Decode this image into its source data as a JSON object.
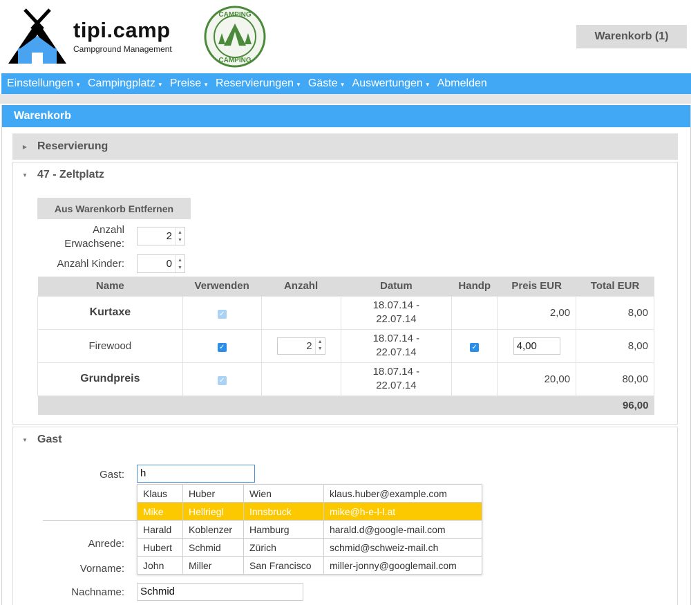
{
  "header": {
    "brand_title": "tipi.camp",
    "brand_subtitle": "Campground Management",
    "badge_text": "CAMPING",
    "cart_label": "Warenkorb (1)"
  },
  "nav": {
    "items": [
      {
        "label": "Einstellungen",
        "dropdown": true
      },
      {
        "label": "Campingplatz",
        "dropdown": true
      },
      {
        "label": "Preise",
        "dropdown": true
      },
      {
        "label": "Reservierungen",
        "dropdown": true
      },
      {
        "label": "Gäste",
        "dropdown": true
      },
      {
        "label": "Auswertungen",
        "dropdown": true
      },
      {
        "label": "Abmelden",
        "dropdown": false
      }
    ]
  },
  "panel": {
    "title": "Warenkorb"
  },
  "sections": {
    "reservation": "Reservierung",
    "site": "47 - Zeltplatz",
    "guest": "Gast"
  },
  "site": {
    "remove_button": "Aus Warenkorb Entfernen",
    "adults_label_1": "Anzahl",
    "adults_label_2": "Erwachsene:",
    "adults_value": "2",
    "children_label": "Anzahl Kinder:",
    "children_value": "0"
  },
  "price_table": {
    "headers": [
      "Name",
      "Verwenden",
      "Anzahl",
      "Datum",
      "Handp",
      "Preis EUR",
      "Total EUR"
    ],
    "rows": [
      {
        "name": "Kurtaxe",
        "date_from": "18.07.14 -",
        "date_to": "22.07.14",
        "price": "2,00",
        "total": "8,00"
      },
      {
        "name": "Firewood",
        "qty": "2",
        "date_from": "18.07.14 -",
        "date_to": "22.07.14",
        "price": "4,00",
        "total": "8,00"
      },
      {
        "name": "Grundpreis",
        "date_from": "18.07.14 -",
        "date_to": "22.07.14",
        "price": "20,00",
        "total": "80,00"
      }
    ],
    "grand_total": "96,00"
  },
  "guest": {
    "guest_label": "Gast:",
    "guest_value": "h",
    "salutation_label": "Anrede:",
    "firstname_label": "Vorname:",
    "lastname_label": "Nachname:",
    "lastname_value": "Schmid",
    "suggestions": [
      {
        "first": "Klaus",
        "last": "Huber",
        "city": "Wien",
        "email": "klaus.huber@example.com"
      },
      {
        "first": "Mike",
        "last": "Hellriegl",
        "city": "Innsbruck",
        "email": "mike@h-e-l-l.at"
      },
      {
        "first": "Harald",
        "last": "Koblenzer",
        "city": "Hamburg",
        "email": "harald.d@google-mail.com"
      },
      {
        "first": "Hubert",
        "last": "Schmid",
        "city": "Zürich",
        "email": "schmid@schweiz-mail.ch"
      },
      {
        "first": "John",
        "last": "Miller",
        "city": "San Francisco",
        "email": "miller-jonny@googlemail.com"
      }
    ]
  },
  "colors": {
    "accent": "#41a8f5",
    "highlight": "#fcc800",
    "logo_house": "#4aa3f0",
    "badge_green": "#4a8a3a"
  }
}
